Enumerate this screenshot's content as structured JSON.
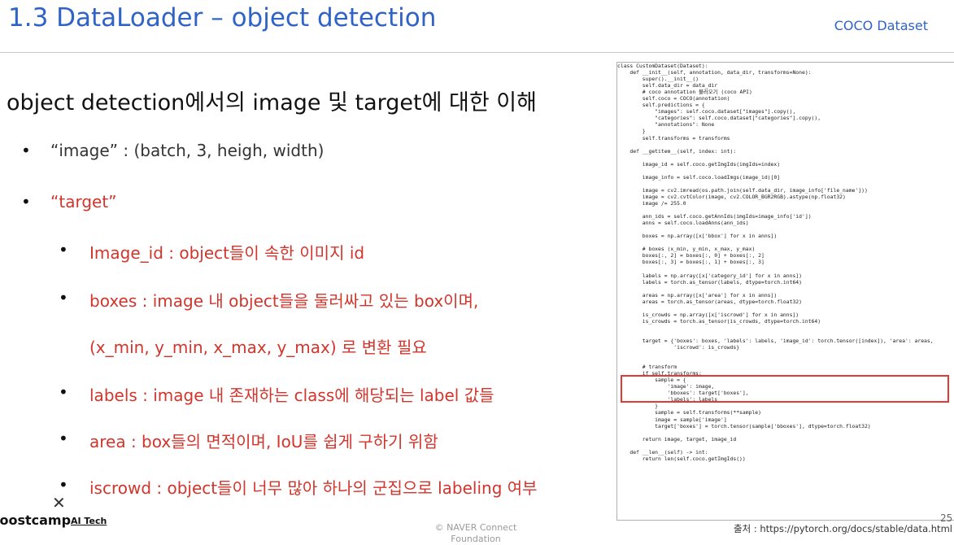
{
  "header": {
    "title": "1.3 DataLoader – object detection",
    "tag": "COCO Dataset"
  },
  "subtitle": "object detection에서의 image 및 target에 대한 이해",
  "bullets": {
    "image": "“image” : (batch, 3, heigh, width)",
    "target": "“target”",
    "image_id": "Image_id : object들이 속한 이미지 id",
    "boxes1": "boxes : image 내 object들을 둘러싸고 있는 box이며,",
    "boxes2": "(x_min, y_min, x_max, y_max) 로 변환 필요",
    "labels": "labels : image 내 존재하는 class에 해당되는 label 값들",
    "area": "area : box들의 면적이며,  IoU를 쉽게 구하기 위함",
    "iscrowd": "iscrowd : object들이 너무 많아 하나의 군집으로 labeling 여부"
  },
  "code_lines": [
    "class CustomDataset(Dataset):",
    "    def __init__(self, annotation, data_dir, transforms=None):",
    "        super().__init__()",
    "        self.data_dir = data_dir",
    "        # coco annotation 불러오기 (coco API)",
    "        self.coco = COCO(annotation)",
    "        self.predictions = {",
    "            \"images\": self.coco.dataset[\"images\"].copy(),",
    "            \"categories\": self.coco.dataset[\"categories\"].copy(),",
    "            \"annotations\": None",
    "        }",
    "        self.transforms = transforms",
    "",
    "    def __getitem__(self, index: int):",
    "",
    "        image_id = self.coco.getImgIds(imgIds=index)",
    "",
    "        image_info = self.coco.loadImgs(image_id)[0]",
    "",
    "        image = cv2.imread(os.path.join(self.data_dir, image_info['file_name']))",
    "        image = cv2.cvtColor(image, cv2.COLOR_BGR2RGB).astype(np.float32)",
    "        image /= 255.0",
    "",
    "        ann_ids = self.coco.getAnnIds(imgIds=image_info['id'])",
    "        anns = self.coco.loadAnns(ann_ids)",
    "",
    "        boxes = np.array([x['bbox'] for x in anns])",
    "",
    "        # boxes (x_min, y_min, x_max, y_max)",
    "        boxes[:, 2] = boxes[:, 0] + boxes[:, 2]",
    "        boxes[:, 3] = boxes[:, 1] + boxes[:, 3]",
    "",
    "        labels = np.array([x['category_id'] for x in anns])",
    "        labels = torch.as_tensor(labels, dtype=torch.int64)",
    "",
    "        areas = np.array([x['area'] for x in anns])",
    "        areas = torch.as_tensor(areas, dtype=torch.float32)",
    "",
    "        is_crowds = np.array([x['iscrowd'] for x in anns])",
    "        is_crowds = torch.as_tensor(is_crowds, dtype=torch.int64)",
    "",
    "",
    "        target = {'boxes': boxes, 'labels': labels, 'image_id': torch.tensor([index]), 'area': areas,",
    "                  'iscrowd': is_crowds}",
    "",
    "",
    "        # transform",
    "        if self.transforms:",
    "            sample = {",
    "                'image': image,",
    "                'bboxes': target['boxes'],",
    "                'labels': labels",
    "            }",
    "            sample = self.transforms(**sample)",
    "            image = sample['image']",
    "            target['boxes'] = torch.tensor(sample['bboxes'], dtype=torch.float32)",
    "",
    "        return image, target, image_id",
    "",
    "    def __len__(self) -> int:",
    "        return len(self.coco.getImgIds())"
  ],
  "source": "출처 : https://pytorch.org/docs/stable/data.html",
  "page_number": "25",
  "footer": {
    "logo": "boostcamp",
    "logo_sub": "AI Tech",
    "copyright": "© NAVER Connect Foundation",
    "close_glyph": "✕"
  },
  "colors": {
    "title": "#2f63c7",
    "target_text": "#d2352c",
    "highlight_box": "#e53935"
  }
}
